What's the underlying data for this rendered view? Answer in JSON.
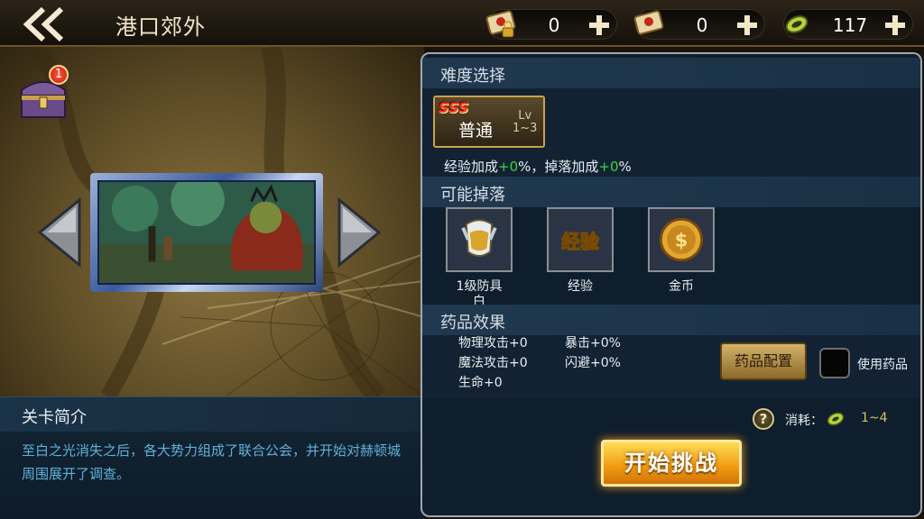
{
  "header": {
    "title": "港口郊外",
    "resources": [
      {
        "icon": "locked-scroll-icon",
        "value": "0"
      },
      {
        "icon": "scroll-icon",
        "value": "0"
      },
      {
        "icon": "stamina-coin-icon",
        "value": "117"
      }
    ]
  },
  "map": {
    "chest_badge": "1"
  },
  "intro": {
    "title": "关卡简介",
    "text": "至白之光消失之后，各大势力组成了联合公会，并开始对赫顿城周围展开了调查。"
  },
  "difficulty": {
    "section_title": "难度选择",
    "rank": "SSS",
    "name": "普通",
    "lv_label": "Lv",
    "lv_range": "1~3",
    "bonus": {
      "exp_label": "经验加成",
      "exp_value": "+0",
      "sep": "%，",
      "drop_label": "掉落加成",
      "drop_value": "+0",
      "tail": "%"
    }
  },
  "drops": {
    "section_title": "可能掉落",
    "items": [
      {
        "label": "1级防具",
        "sublabel": "白",
        "icon": "armor-icon"
      },
      {
        "label": "经验",
        "sublabel": "",
        "icon": "exp-icon"
      },
      {
        "label": "金币",
        "sublabel": "",
        "icon": "gold-coin-icon"
      }
    ],
    "exp_icon_text": "经验"
  },
  "potion": {
    "section_title": "药品效果",
    "stats": {
      "physical": "物理攻击+0",
      "magic": "魔法攻击+0",
      "hp": "生命+0",
      "crit": "暴击+0%",
      "dodge": "闪避+0%"
    },
    "config_label": "药品配置",
    "use_label": "使用药品"
  },
  "cost": {
    "help": "?",
    "label": "消耗：",
    "value": "1~4"
  },
  "start_label": "开始挑战",
  "colors": {
    "accent_gold": "#f09a10",
    "bonus_green": "#38d83c",
    "intro_text": "#5fb2d9"
  }
}
